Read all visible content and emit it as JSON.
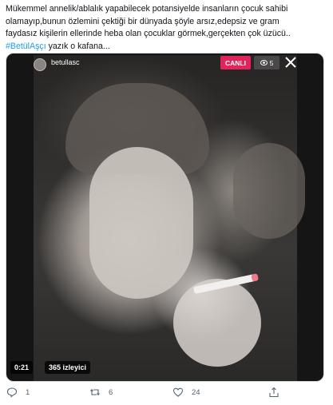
{
  "tweet": {
    "line1": "Mükemmel annelik/ablalık yapabilecek potansiyelde insanların çocuk sahibi",
    "line2": "olamayıp,bunun özlemini çektiği bir dünyada şöyle arsız,edepsiz ve gram",
    "line3": "faydasız kişilerin ellerinde heba olan çocuklar görmek,gerçekten çok üzücü..",
    "hashtag": "#BetülAşçı",
    "line4_rest": " yazık o kafana..."
  },
  "video": {
    "username": "betullasc",
    "live_label": "CANLI",
    "viewer_count": "5",
    "time": "0:21",
    "views_label": "365 izleyici"
  },
  "actions": {
    "replies": "1",
    "retweets": "6",
    "likes": "24"
  },
  "colors": {
    "accent": "#1d9bf0",
    "live": "#e2245c",
    "muted": "#536471"
  }
}
